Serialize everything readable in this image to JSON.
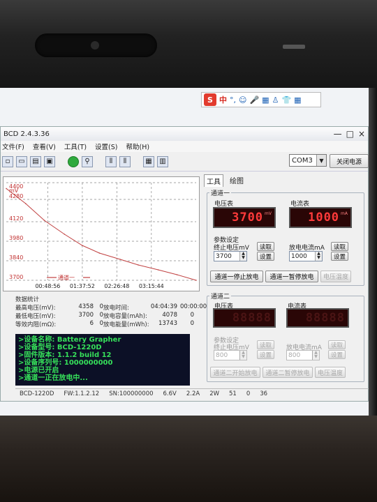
{
  "ime": {
    "logo": "S",
    "mode": "中",
    "glyphs": [
      "°,",
      "☺",
      "🎤",
      "▦",
      "♙",
      "👕",
      "▦"
    ]
  },
  "window": {
    "title": "BCD 2.4.3.36",
    "controls": [
      "—",
      "□",
      "×"
    ]
  },
  "menu": [
    "文件(F)",
    "查看(V)",
    "工具(T)",
    "设置(S)",
    "帮助(H)"
  ],
  "toolbar": {
    "com_port": "COM3",
    "close_power_label": "关闭电源"
  },
  "chart_data": {
    "type": "line",
    "legend": "通道一",
    "y_ticks": [
      4400,
      4280,
      4120,
      3980,
      3840,
      3700
    ],
    "y_unit": "mV",
    "x_ticks": [
      "00:48:56",
      "01:37:52",
      "02:26:48",
      "03:15:44"
    ],
    "ylim": [
      3700,
      4400
    ],
    "x_max_seconds": 14679,
    "series": [
      {
        "name": "通道一",
        "color": "#c04040",
        "x_seconds": [
          0,
          1500,
          2936,
          4500,
          5872,
          7200,
          8808,
          10200,
          11744,
          13200,
          14679
        ],
        "values": [
          4358,
          4250,
          4130,
          4030,
          3950,
          3895,
          3850,
          3810,
          3775,
          3740,
          3700
        ]
      }
    ],
    "grid": true
  },
  "stats": {
    "title": "数据统计",
    "rows": [
      {
        "l1": "最高电压(mV):",
        "v1": "4358",
        "v2": "0",
        "l2": "放电时间:",
        "v3": "04:04:39",
        "v4": "00:00:00"
      },
      {
        "l1": "最低电压(mV):",
        "v1": "3700",
        "v2": "0",
        "l2": "放电容量(mAh):",
        "v3": "4078",
        "v4": "0"
      },
      {
        "l1": "等效内阻(mΩ):",
        "v1": "6",
        "v2": "0",
        "l2": "放电能量(mWh):",
        "v3": "13743",
        "v4": "0"
      }
    ]
  },
  "console": {
    "lines": [
      ">设备名称: Battery Grapher",
      ">设备型号: BCD-1220D",
      ">固件版本: 1.1.2 build 12",
      ">设备序列号: 1000000000",
      ">电源已开启",
      ">通道一正在放电中..."
    ]
  },
  "statusbar": [
    "BCD-1220D",
    "FW:1.1.2.12",
    "SN:100000000",
    "6.6V",
    "2.2A",
    "2W",
    "51",
    "0",
    "36"
  ],
  "tabs": [
    "工具",
    "绘图"
  ],
  "ch1": {
    "title": "通道一",
    "voltmeter_label": "电压表",
    "voltage": "3700",
    "voltage_unit": "mV",
    "ammeter_label": "电流表",
    "current": "1000",
    "current_unit": "mA",
    "params_title": "参数设定",
    "cutoff_label": "终止电压mV",
    "cutoff_value": "3700",
    "read_label": "读取",
    "set_label": "设置",
    "discharge_label": "放电电流mA",
    "discharge_value": "1000",
    "read2_label": "读取",
    "set2_label": "设置",
    "stop_btn": "通道一停止放电",
    "pause_btn": "通道一暂停放电",
    "clear_btn": "电压温度"
  },
  "ch2": {
    "title": "通道二",
    "voltmeter_label": "电压表",
    "ammeter_label": "电流表",
    "params_title": "参数设定",
    "cutoff_label": "终止电压mV",
    "cutoff_value": "800",
    "discharge_label": "放电电流mA",
    "discharge_value": "800",
    "read_label": "读取",
    "set_label": "设置",
    "read2_label": "读取",
    "set2_label": "设置",
    "start_btn": "通道二开始放电",
    "pause_btn": "通道二暂停放电",
    "clear_btn": "电压温度"
  }
}
